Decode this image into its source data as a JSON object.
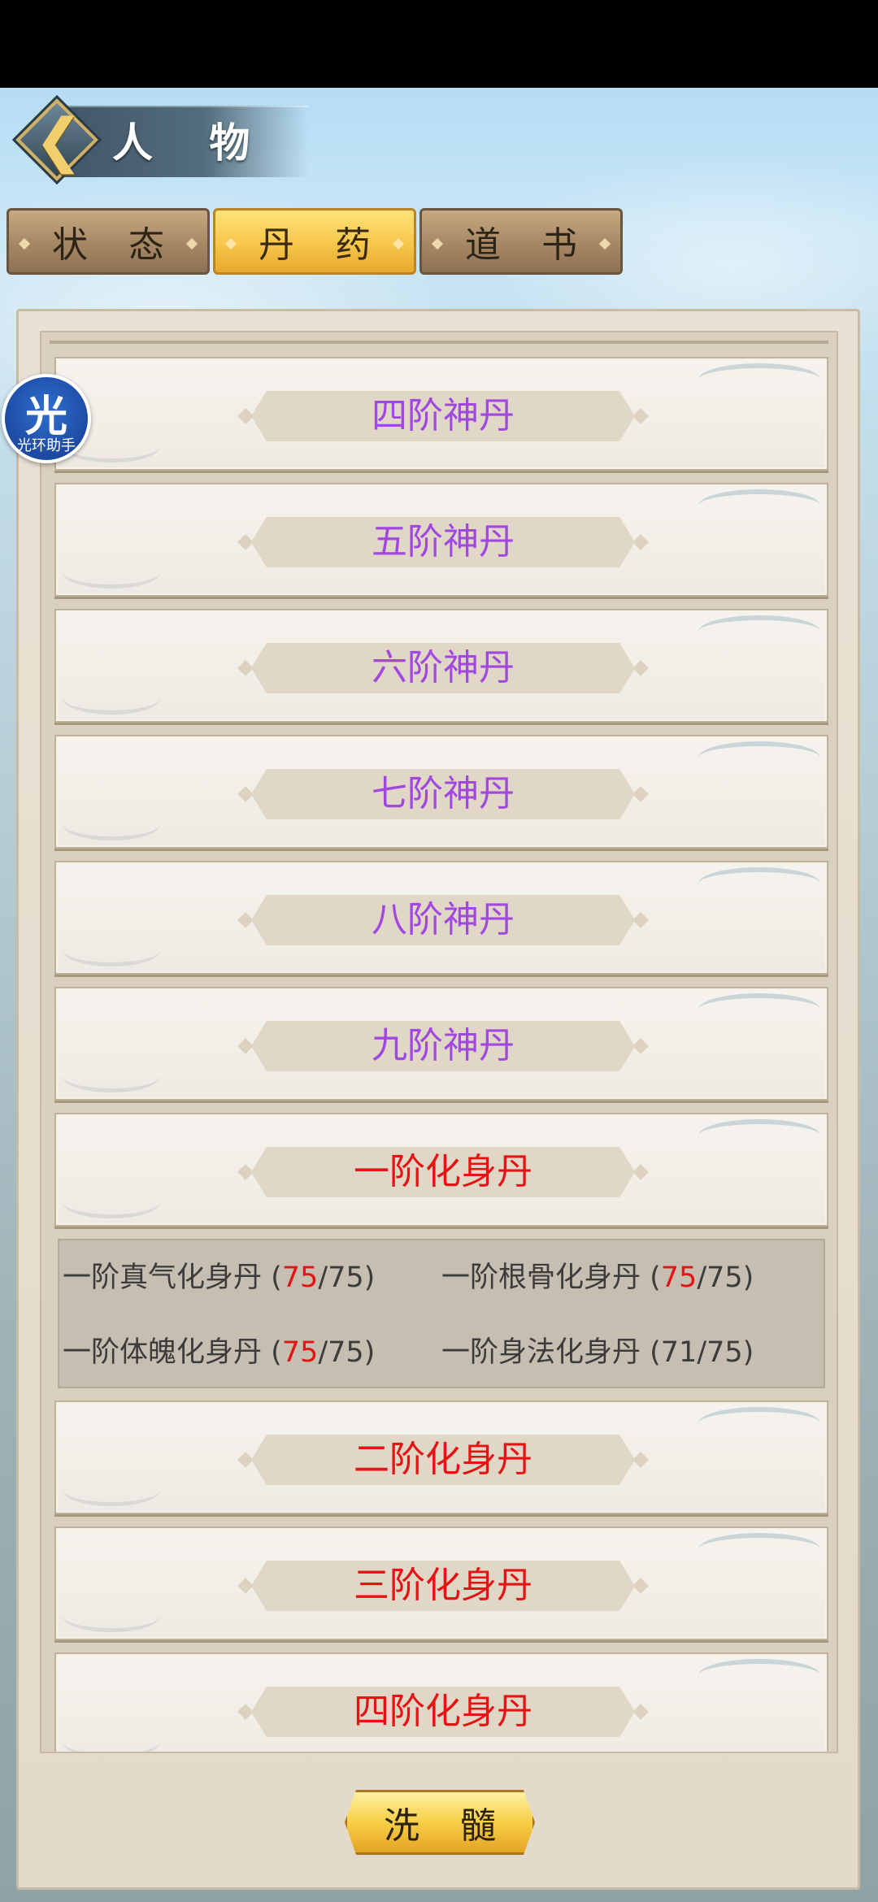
{
  "header": {
    "title": "人 物",
    "back_icon": "chevron-left-icon"
  },
  "tabs": [
    {
      "label": "状 态",
      "active": false
    },
    {
      "label": "丹 药",
      "active": true
    },
    {
      "label": "道 书",
      "active": false
    }
  ],
  "pill_list": [
    {
      "label": "四阶神丹",
      "color": "#a148e0"
    },
    {
      "label": "五阶神丹",
      "color": "#a148e0"
    },
    {
      "label": "六阶神丹",
      "color": "#a148e0"
    },
    {
      "label": "七阶神丹",
      "color": "#a148e0"
    },
    {
      "label": "八阶神丹",
      "color": "#a148e0"
    },
    {
      "label": "九阶神丹",
      "color": "#a148e0"
    },
    {
      "label": "一阶化身丹",
      "color": "#e21414",
      "expanded": true
    },
    {
      "label": "二阶化身丹",
      "color": "#e21414"
    },
    {
      "label": "三阶化身丹",
      "color": "#e21414"
    },
    {
      "label": "四阶化身丹",
      "color": "#e21414"
    }
  ],
  "expanded_details": [
    {
      "name": "一阶真气化身丹 (",
      "used": "75",
      "max": "/75)"
    },
    {
      "name": "一阶根骨化身丹 (",
      "used": "75",
      "max": "/75)"
    },
    {
      "name": "一阶体魄化身丹 (",
      "used": "75",
      "max": "/75)"
    },
    {
      "name": "一阶身法化身丹 (",
      "used": "71",
      "max": "/75)"
    }
  ],
  "wash_button": {
    "label": "洗 髓"
  },
  "helper_badge": {
    "glyph": "光",
    "label": "光环助手"
  },
  "colors": {
    "purple_tier": "#a148e0",
    "red_tier": "#e21414",
    "active_tab": "#f6c64a"
  }
}
